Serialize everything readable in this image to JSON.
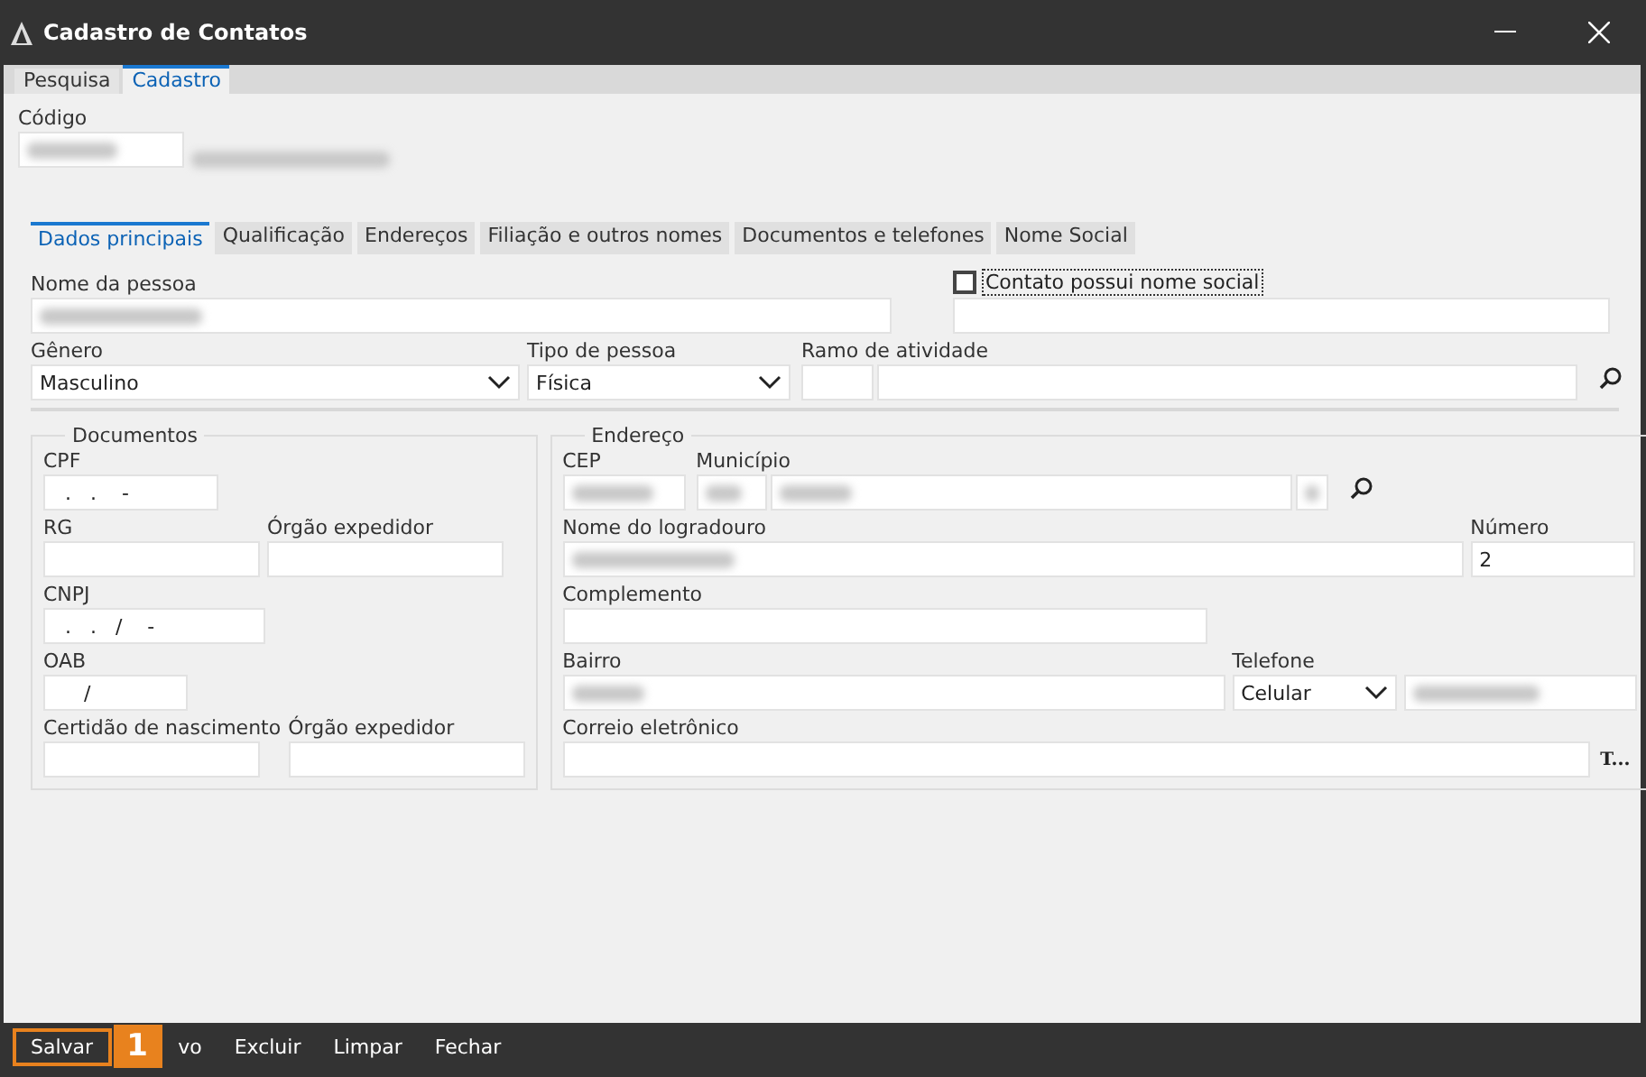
{
  "window": {
    "title": "Cadastro de Contatos"
  },
  "tabs": [
    {
      "label": "Pesquisa",
      "selected": false
    },
    {
      "label": "Cadastro",
      "selected": true
    }
  ],
  "codigo": {
    "label": "Código",
    "blurred": true
  },
  "codigo_description": {
    "blurred": true
  },
  "subtabs": [
    {
      "label": "Dados principais",
      "selected": true
    },
    {
      "label": "Qualificação",
      "selected": false
    },
    {
      "label": "Endereços",
      "selected": false
    },
    {
      "label": "Filiação e outros nomes",
      "selected": false
    },
    {
      "label": "Documentos e telefones",
      "selected": false
    },
    {
      "label": "Nome Social",
      "selected": false
    }
  ],
  "nome": {
    "label": "Nome da pessoa",
    "blurred": true
  },
  "social": {
    "label": "Contato possui nome social",
    "checked": false
  },
  "genero": {
    "label": "Gênero",
    "value": "Masculino"
  },
  "tipo": {
    "label": "Tipo de pessoa",
    "value": "Física"
  },
  "ramo": {
    "label": "Ramo de atividade"
  },
  "documentos": {
    "title": "Documentos",
    "rows": [
      [
        {
          "label": "CPF",
          "value": "  .   .    -"
        }
      ],
      [
        {
          "label": "RG"
        },
        {
          "label": "Órgão expedidor"
        }
      ],
      [
        {
          "label": "CNPJ",
          "value": "  .   .   /    -"
        }
      ],
      [
        {
          "label": "OAB",
          "value": "     /"
        }
      ],
      [
        {
          "label": "Certidão de nascimento"
        },
        {
          "label": "Órgão expedidor"
        }
      ]
    ]
  },
  "endereco": {
    "title": "Endereço",
    "cep": {
      "label": "CEP",
      "blurred": true
    },
    "municipio": {
      "label": "Município",
      "blurred": true
    },
    "logradouro": {
      "label": "Nome do logradouro",
      "blurred": true
    },
    "numero": {
      "label": "Número",
      "value": "2"
    },
    "complemento": {
      "label": "Complemento"
    },
    "bairro": {
      "label": "Bairro",
      "blurred": true
    },
    "telefone": {
      "label": "Telefone",
      "type": "Celular",
      "blurred": true
    },
    "email": {
      "label": "Correio eletrônico",
      "button": "T..."
    }
  },
  "toolbar": {
    "buttons": [
      {
        "label": "Salvar",
        "highlighted": true
      },
      {
        "label": "vo",
        "highlighted": false
      },
      {
        "label": "Excluir",
        "highlighted": false
      },
      {
        "label": "Limpar",
        "highlighted": false
      },
      {
        "label": "Fechar",
        "highlighted": false
      }
    ],
    "badge": "1"
  }
}
